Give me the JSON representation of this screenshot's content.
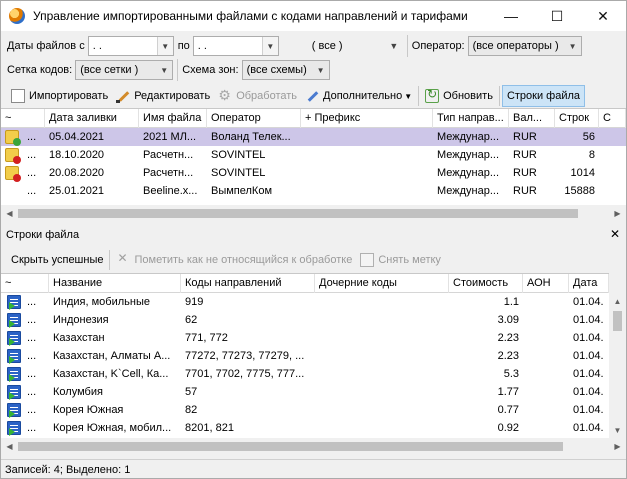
{
  "window": {
    "title": "Управление импортированными файлами с кодами направлений и тарифами",
    "minimize": "—",
    "maximize": "☐",
    "close": "✕"
  },
  "filters": {
    "dates_label": "Даты файлов с",
    "date_from": " .  .",
    "to_label": "по",
    "date_to": " .  .",
    "period_value": "( все )",
    "operator_label": "Оператор:",
    "operator_value": "(все операторы )",
    "grid_label": "Сетка кодов:",
    "grid_value": "(все сетки )",
    "zone_label": "Схема зон:",
    "zone_value": "(все схемы)"
  },
  "toolbar": {
    "import": "Импортировать",
    "edit": "Редактировать",
    "process": "Обработать",
    "more": "Дополнительно",
    "refresh": "Обновить",
    "file_lines": "Строки файла"
  },
  "files_grid": {
    "columns": [
      "~",
      "Дата заливки",
      "Имя файла",
      "Оператор",
      "+ Префикс",
      "Тип направ...",
      "Вал...",
      "Строк",
      "С"
    ],
    "rows": [
      {
        "icon": "folder-ok-icon",
        "mark": "...",
        "date": "05.04.2021",
        "file": "2021 МЛ...",
        "operator": "Воланд Телек...",
        "prefix": "",
        "type": "Междунар...",
        "currency": "RUR",
        "lines": "56",
        "selected": true
      },
      {
        "icon": "folder-error-icon",
        "mark": "...",
        "date": "18.10.2020",
        "file": "Расчетн...",
        "operator": "SOVINTEL",
        "prefix": "",
        "type": "Междунар...",
        "currency": "RUR",
        "lines": "8",
        "selected": false
      },
      {
        "icon": "folder-error-icon",
        "mark": "...",
        "date": "20.08.2020",
        "file": "Расчетн...",
        "operator": "SOVINTEL",
        "prefix": "",
        "type": "Междунар...",
        "currency": "RUR",
        "lines": "1014",
        "selected": false
      },
      {
        "icon": "",
        "mark": "...",
        "date": "25.01.2021",
        "file": "Beeline.x...",
        "operator": "ВымпелКом",
        "prefix": "",
        "type": "Междунар...",
        "currency": "RUR",
        "lines": "15888",
        "selected": false
      }
    ]
  },
  "lines_panel": {
    "title": "Строки файла",
    "close": "✕",
    "hide_success": "Скрыть успешные",
    "mark_ignored": "Пометить как не относящийся к обработке",
    "unmark": "Снять метку"
  },
  "lines_grid": {
    "columns": [
      "~",
      "Название",
      "Коды направлений",
      "Дочерние коды",
      "Стоимость",
      "АОН",
      "Дата"
    ],
    "rows": [
      {
        "mark": "...",
        "name": "Индия, мобильные",
        "codes": "919",
        "child": "",
        "cost": "1.1",
        "aon": "",
        "date": "01.04."
      },
      {
        "mark": "...",
        "name": "Индонезия",
        "codes": "62",
        "child": "",
        "cost": "3.09",
        "aon": "",
        "date": "01.04."
      },
      {
        "mark": "...",
        "name": "Казахстан",
        "codes": "771, 772",
        "child": "",
        "cost": "2.23",
        "aon": "",
        "date": "01.04."
      },
      {
        "mark": "...",
        "name": "Казахстан, Алматы А...",
        "codes": "77272, 77273, 77279, ...",
        "child": "",
        "cost": "2.23",
        "aon": "",
        "date": "01.04."
      },
      {
        "mark": "...",
        "name": "Казахстан, K`Cell, Ка...",
        "codes": "7701, 7702, 7775, 777...",
        "child": "",
        "cost": "5.3",
        "aon": "",
        "date": "01.04."
      },
      {
        "mark": "...",
        "name": "Колумбия",
        "codes": "57",
        "child": "",
        "cost": "1.77",
        "aon": "",
        "date": "01.04."
      },
      {
        "mark": "...",
        "name": "Корея Южная",
        "codes": "82",
        "child": "",
        "cost": "0.77",
        "aon": "",
        "date": "01.04."
      },
      {
        "mark": "...",
        "name": "Корея Южная, мобил...",
        "codes": "8201, 821",
        "child": "",
        "cost": "0.92",
        "aon": "",
        "date": "01.04."
      }
    ]
  },
  "status": {
    "text": "Записей: 4; Выделено: 1"
  },
  "colors": {
    "selected_row": "#cdc6e8",
    "active_button": "#cce4f7"
  }
}
